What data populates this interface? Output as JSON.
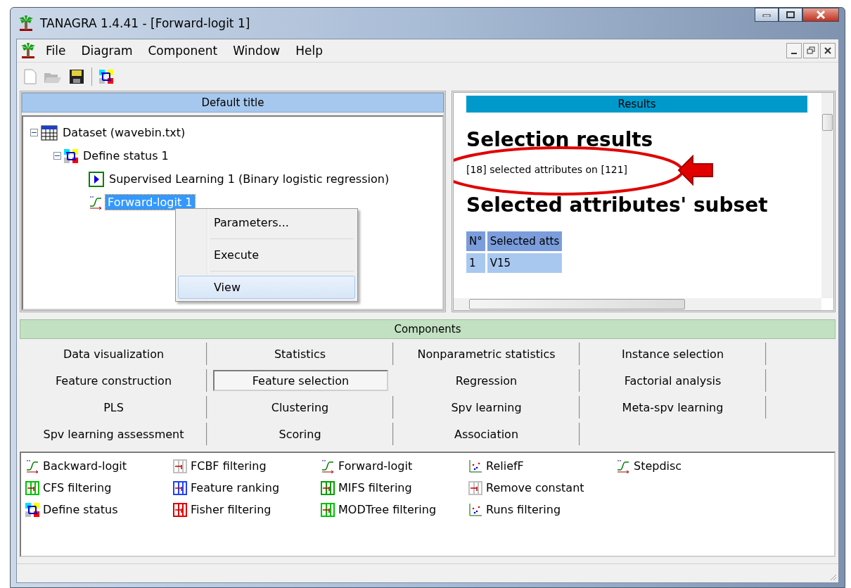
{
  "window": {
    "title": "TANAGRA 1.4.41 - [Forward-logit 1]"
  },
  "menu": [
    "File",
    "Diagram",
    "Component",
    "Window",
    "Help"
  ],
  "diagram": {
    "title": "Default title",
    "tree": [
      {
        "label": "Dataset (wavebin.txt)",
        "expanded": true,
        "selected": false,
        "children": [
          {
            "label": "Define status 1",
            "expanded": true,
            "selected": false,
            "children": [
              {
                "label": "Supervised Learning 1 (Binary logistic regression)",
                "selected": false
              },
              {
                "label": "Forward-logit 1",
                "selected": true
              }
            ]
          }
        ]
      }
    ]
  },
  "context_menu": [
    {
      "label": "Parameters...",
      "selected": false
    },
    {
      "label": "Execute",
      "selected": false
    },
    {
      "label": "View",
      "selected": true
    }
  ],
  "results": {
    "title": "Results",
    "heading": "Selection results",
    "summary": "[18] selected attributes on [121]",
    "subheading": "Selected attributes' subset",
    "table": {
      "columns": [
        "N°",
        "Selected atts"
      ],
      "rows": [
        [
          "1",
          "V15"
        ]
      ]
    }
  },
  "components": {
    "title": "Components",
    "tabs": [
      {
        "label": "Data visualization",
        "selected": false
      },
      {
        "label": "Statistics",
        "selected": false
      },
      {
        "label": "Nonparametric statistics",
        "selected": false
      },
      {
        "label": "Instance selection",
        "selected": false
      },
      {
        "label": "Feature construction",
        "selected": false
      },
      {
        "label": "Feature selection",
        "selected": true
      },
      {
        "label": "Regression",
        "selected": false
      },
      {
        "label": "Factorial analysis",
        "selected": false
      },
      {
        "label": "PLS",
        "selected": false
      },
      {
        "label": "Clustering",
        "selected": false
      },
      {
        "label": "Spv learning",
        "selected": false
      },
      {
        "label": "Meta-spv learning",
        "selected": false
      },
      {
        "label": "Spv learning assessment",
        "selected": false
      },
      {
        "label": "Scoring",
        "selected": false
      },
      {
        "label": "Association",
        "selected": false
      }
    ],
    "items": [
      {
        "label": "Backward-logit",
        "kind": "curve"
      },
      {
        "label": "CFS filtering",
        "kind": "filter"
      },
      {
        "label": "Define status",
        "kind": "status"
      },
      {
        "label": "FCBF filtering",
        "kind": "filter"
      },
      {
        "label": "Feature ranking",
        "kind": "filter"
      },
      {
        "label": "Fisher filtering",
        "kind": "filter"
      },
      {
        "label": "Forward-logit",
        "kind": "curve"
      },
      {
        "label": "MIFS filtering",
        "kind": "filter"
      },
      {
        "label": "MODTree filtering",
        "kind": "filter"
      },
      {
        "label": "ReliefF",
        "kind": "scatter"
      },
      {
        "label": "Remove constant",
        "kind": "filter"
      },
      {
        "label": "Runs filtering",
        "kind": "scatter"
      },
      {
        "label": "Stepdisc",
        "kind": "curve"
      }
    ]
  }
}
